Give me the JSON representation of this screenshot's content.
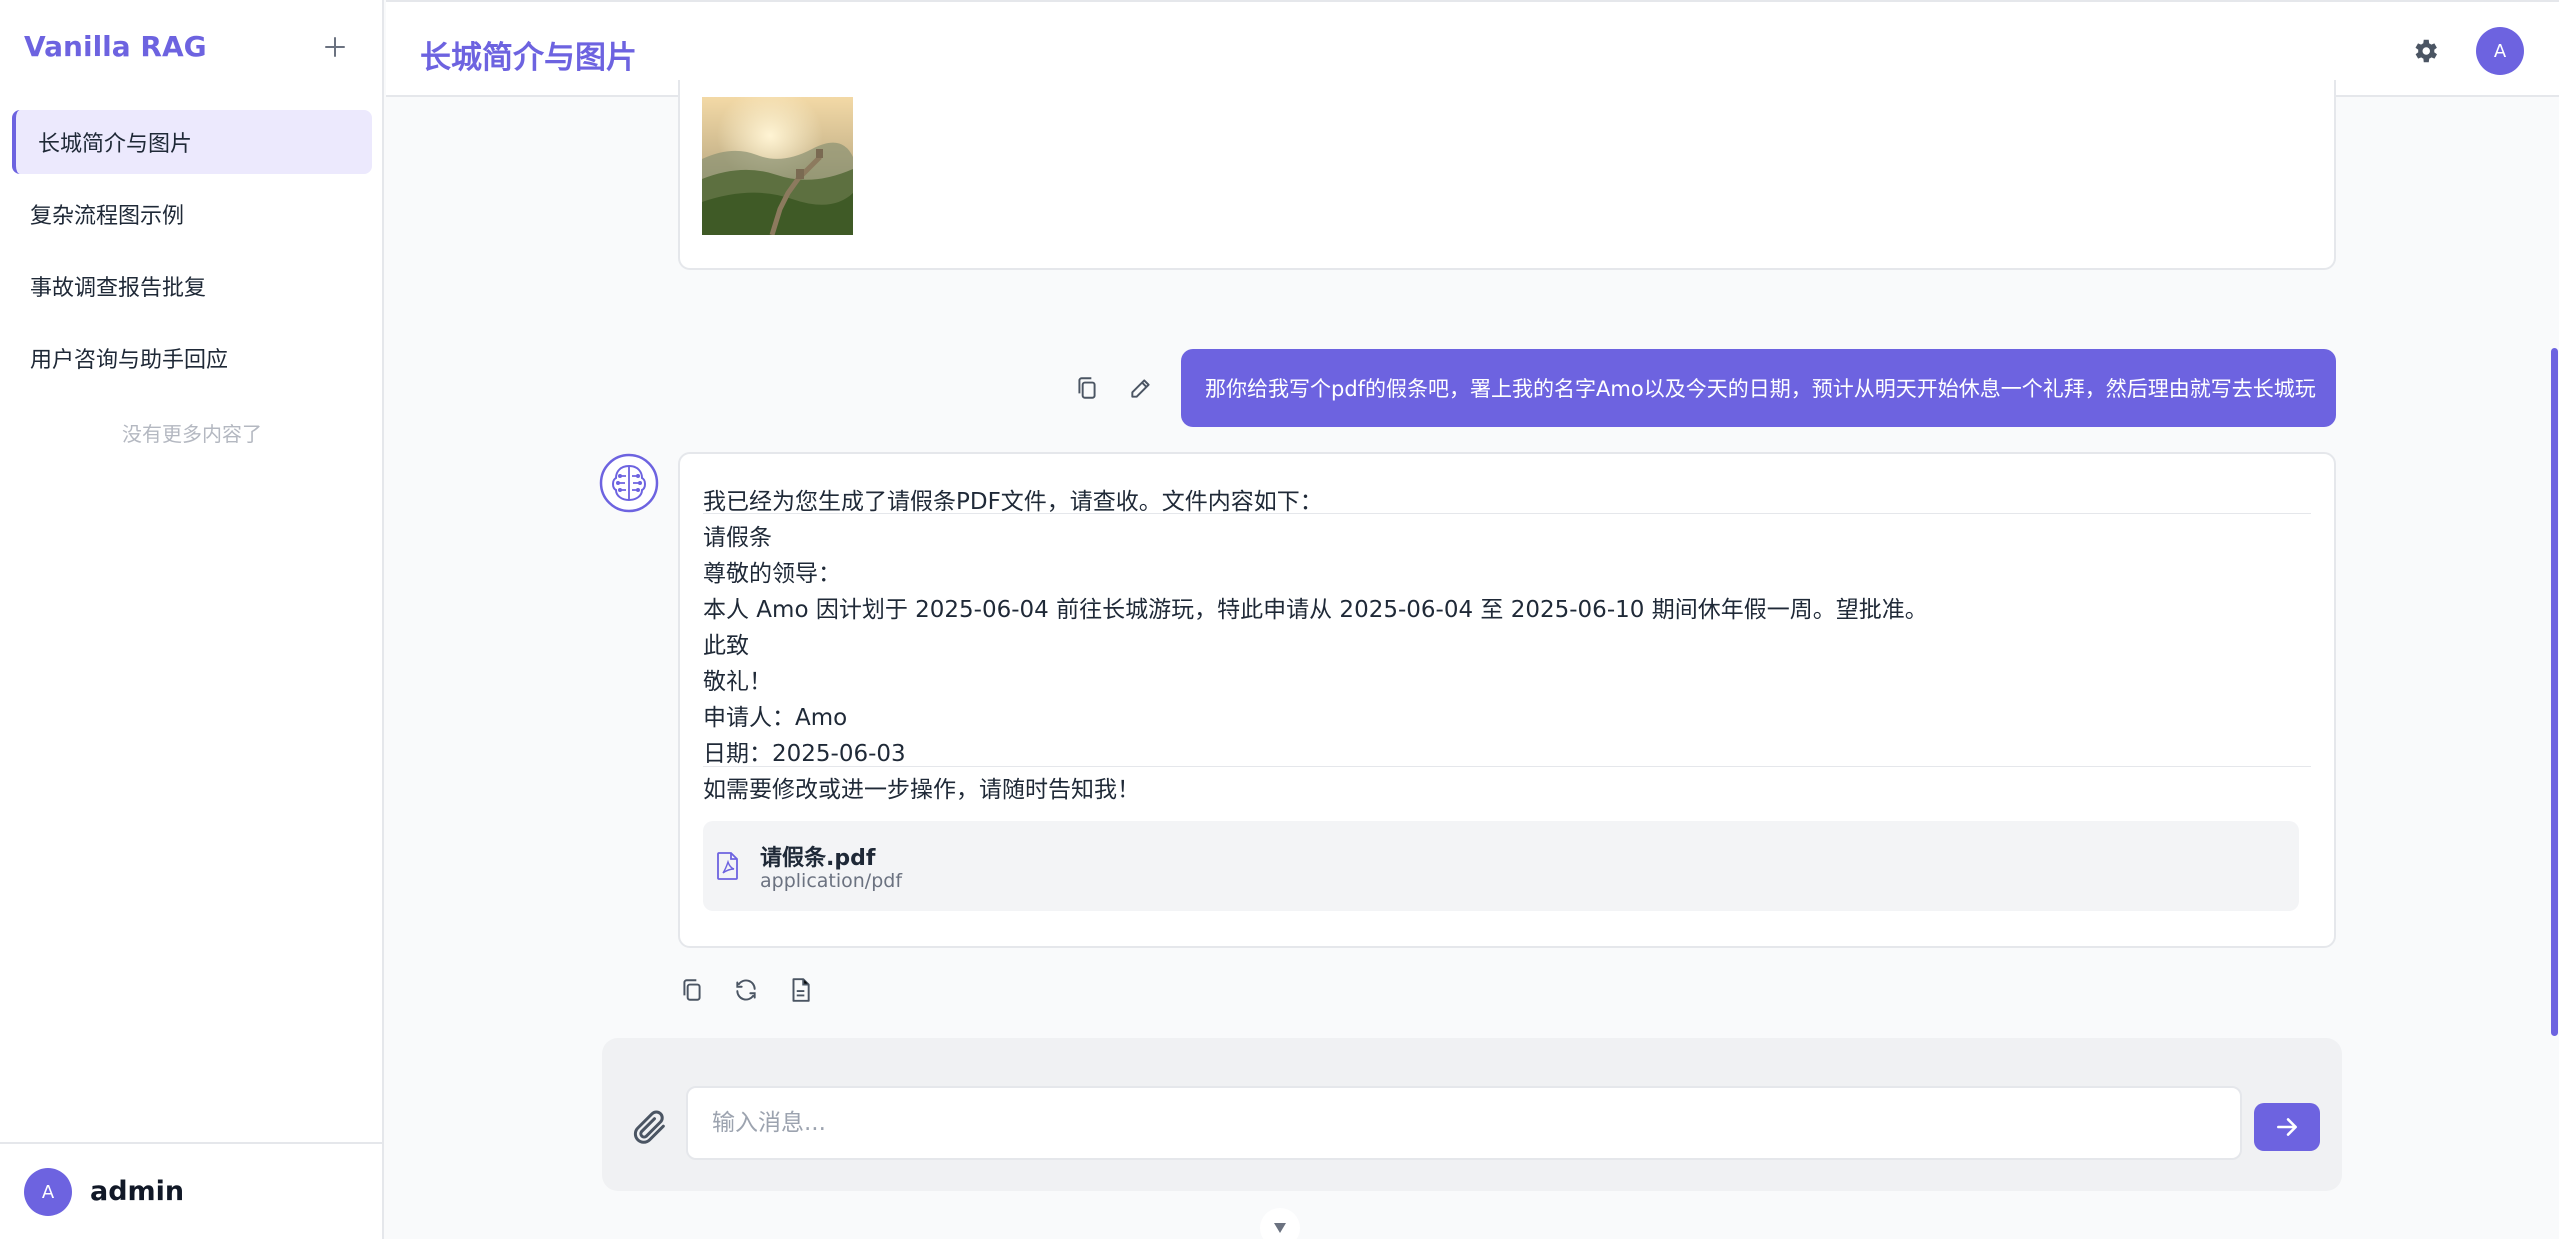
{
  "sidebar": {
    "brand": "Vanilla RAG",
    "items": [
      {
        "label": "长城简介与图片"
      },
      {
        "label": "复杂流程图示例"
      },
      {
        "label": "事故调查报告批复"
      },
      {
        "label": "用户咨询与助手回应"
      }
    ],
    "empty_text": "没有更多内容了",
    "user": {
      "avatar": "A",
      "name": "admin"
    }
  },
  "header": {
    "title": "长城简介与图片",
    "avatar": "A"
  },
  "messages": {
    "user_text": "那你给我写个pdf的假条吧，署上我的名字Amo以及今天的日期，预计从明天开始休息一个礼拜，然后理由就写去长城玩",
    "assistant_lines": [
      "我已经为您生成了请假条PDF文件，请查收。文件内容如下：",
      "请假条",
      "尊敬的领导：",
      "本人 Amo 因计划于 2025-06-04 前往长城游玩，特此申请从 2025-06-04 至 2025-06-10 期间休年假一周。望批准。",
      "此致",
      "敬礼！",
      "申请人：Amo",
      "日期：2025-06-03",
      "如需要修改或进一步操作，请随时告知我！"
    ],
    "attachment": {
      "name": "请假条.pdf",
      "type": "application/pdf"
    }
  },
  "composer": {
    "placeholder": "输入消息..."
  },
  "colors": {
    "accent": "#6d63e0"
  }
}
